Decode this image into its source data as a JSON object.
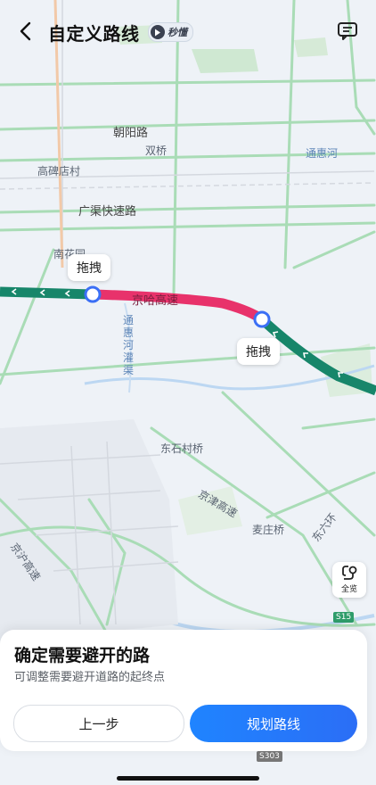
{
  "header": {
    "title": "自定义路线",
    "badge_label": "秒懂"
  },
  "map": {
    "roads": {
      "chaoyang": "朝阳路",
      "shuangqiao": "双桥",
      "tonghuihe": "通惠河",
      "gaobeidian": "高碑店村",
      "guangqu": "广渠快速路",
      "nanhuayuan": "南花园",
      "jinghu_seg": "京哈高速",
      "canal_1": "通",
      "canal_2": "惠",
      "canal_3": "河",
      "canal_4": "灌",
      "canal_5": "渠",
      "dongshicun": "东石村桥",
      "jingjin": "京津高速",
      "maizhuang": "麦庄桥",
      "donglianghuan": "东六环",
      "jinghu": "京沪高速"
    },
    "drag_start": "拖拽",
    "drag_end": "拖拽",
    "shield_s15": "S15",
    "shield_s303": "S303",
    "colors": {
      "route_green": "#17866a",
      "route_red": "#e8326b",
      "marker_blue": "#3b6ff5"
    }
  },
  "overview": {
    "label": "全览"
  },
  "sheet": {
    "title": "确定需要避开的路",
    "subtitle": "可调整需要避开道路的起终点",
    "prev_button": "上一步",
    "plan_button": "规划路线"
  }
}
